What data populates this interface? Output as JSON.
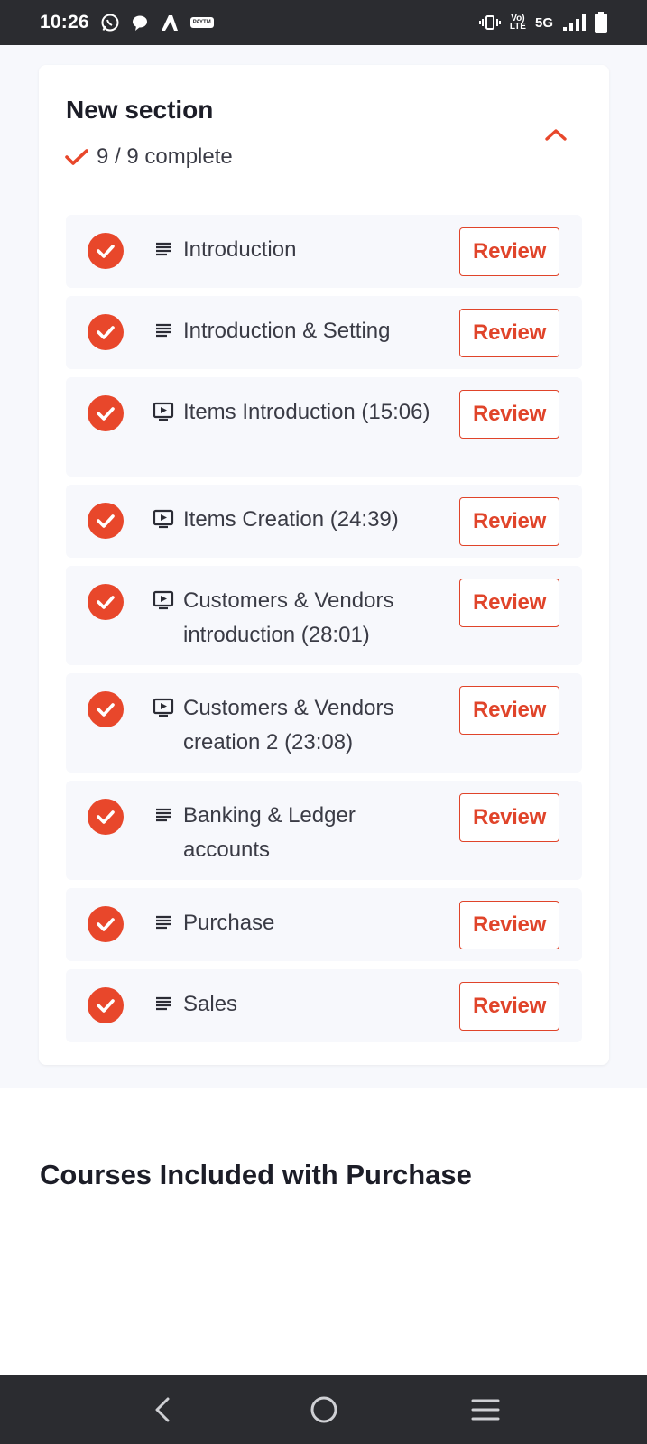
{
  "status_bar": {
    "time": "10:26",
    "left_icons": [
      "whatsapp-icon",
      "chat-bubble-icon",
      "airtel-icon",
      "paytm-icon"
    ],
    "paytm_label": "PAYTM",
    "network_volte": "Vo)",
    "network_lte": "LTE",
    "network_type": "5G",
    "right_icons": [
      "vibrate-icon",
      "signal-icon",
      "battery-icon"
    ]
  },
  "section": {
    "title": "New section",
    "progress": "9 / 9 complete",
    "collapse_icon": "chevron-up-icon",
    "accent_color": "#e8472b"
  },
  "lessons": [
    {
      "title": "Introduction",
      "type": "text",
      "action": "Review",
      "completed": true
    },
    {
      "title": "Introduction & Setting",
      "type": "text",
      "action": "Review",
      "completed": true
    },
    {
      "title": "Items Introduction (15:06)",
      "type": "video",
      "action": "Review",
      "completed": true
    },
    {
      "title": "Items Creation (24:39)",
      "type": "video",
      "action": "Review",
      "completed": true
    },
    {
      "title": "Customers & Vendors introduction (28:01)",
      "type": "video",
      "action": "Review",
      "completed": true
    },
    {
      "title": "Customers & Vendors creation 2 (23:08)",
      "type": "video",
      "action": "Review",
      "completed": true
    },
    {
      "title": "Banking & Ledger accounts",
      "type": "text",
      "action": "Review",
      "completed": true
    },
    {
      "title": "Purchase",
      "type": "text",
      "action": "Review",
      "completed": true
    },
    {
      "title": "Sales",
      "type": "text",
      "action": "Review",
      "completed": true
    }
  ],
  "courses_section": {
    "title": "Courses Included with Purchase"
  },
  "nav_bar": {
    "icons": [
      "back-icon",
      "home-icon",
      "recents-icon"
    ]
  }
}
